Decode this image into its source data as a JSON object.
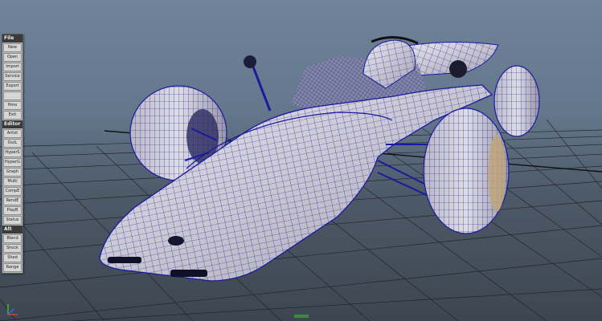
{
  "menu": {
    "sections": [
      {
        "header": "File",
        "items": [
          "New",
          "Open",
          "Import",
          "Service",
          "Export",
          "",
          "Hmo",
          "Exit"
        ]
      },
      {
        "header": "Editor",
        "items": [
          "Artist",
          "OutL",
          "HyperS",
          "HyperG",
          "Graph",
          "Multi",
          "CompE",
          "RendE",
          "PlayB",
          "Status"
        ]
      },
      {
        "header": "Alt",
        "items": [
          "Blend",
          "Shock",
          "Shed",
          "Range"
        ]
      }
    ]
  },
  "colors": {
    "wire": "#1a1a9e",
    "surface": "#d9d6de",
    "grid_line": "#1e1e1e",
    "background_top": "#6f8399",
    "background_bottom": "#3d4650"
  },
  "icons": {
    "axis": "xyz-axis-icon"
  }
}
